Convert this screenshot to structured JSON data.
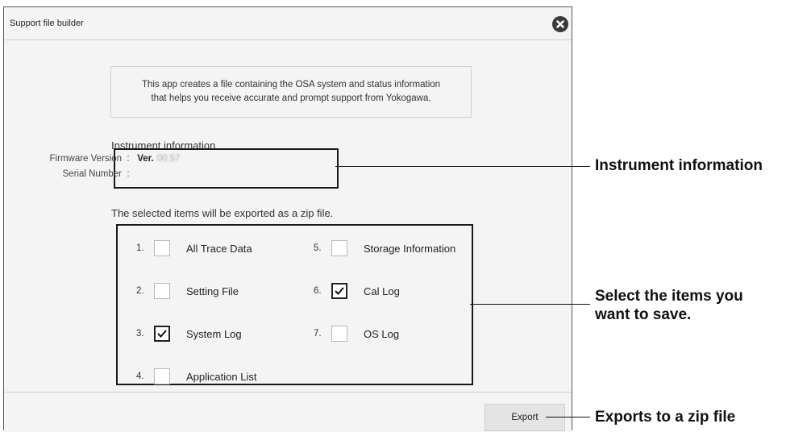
{
  "window": {
    "title": "Support file builder",
    "close_icon": "close-circle-icon"
  },
  "intro": {
    "line1": "This app creates a file containing the OSA system and status information",
    "line2": "that helps you receive accurate and prompt support from Yokogawa."
  },
  "instrument_info": {
    "heading": "Instrument information",
    "firmware_label": "Firmware Version",
    "firmware_value": "Ver.",
    "firmware_number_obscured": "00.57",
    "serial_label": "Serial Number",
    "serial_value": "",
    "separator": ":"
  },
  "export_note": "The selected items will be exported as a zip file.",
  "items": [
    {
      "num": "1.",
      "label": "All Trace Data",
      "checked": false
    },
    {
      "num": "2.",
      "label": "Setting File",
      "checked": false
    },
    {
      "num": "3.",
      "label": "System Log",
      "checked": true
    },
    {
      "num": "4.",
      "label": "Application List",
      "checked": false
    },
    {
      "num": "5.",
      "label": "Storage Information",
      "checked": false
    },
    {
      "num": "6.",
      "label": "Cal Log",
      "checked": true
    },
    {
      "num": "7.",
      "label": "OS Log",
      "checked": false
    }
  ],
  "footer": {
    "export_label": "Export"
  },
  "callouts": {
    "instrument_info": "Instrument information",
    "select_items_line1": "Select the items you",
    "select_items_line2": "want to save.",
    "export": "Exports to a zip file"
  }
}
